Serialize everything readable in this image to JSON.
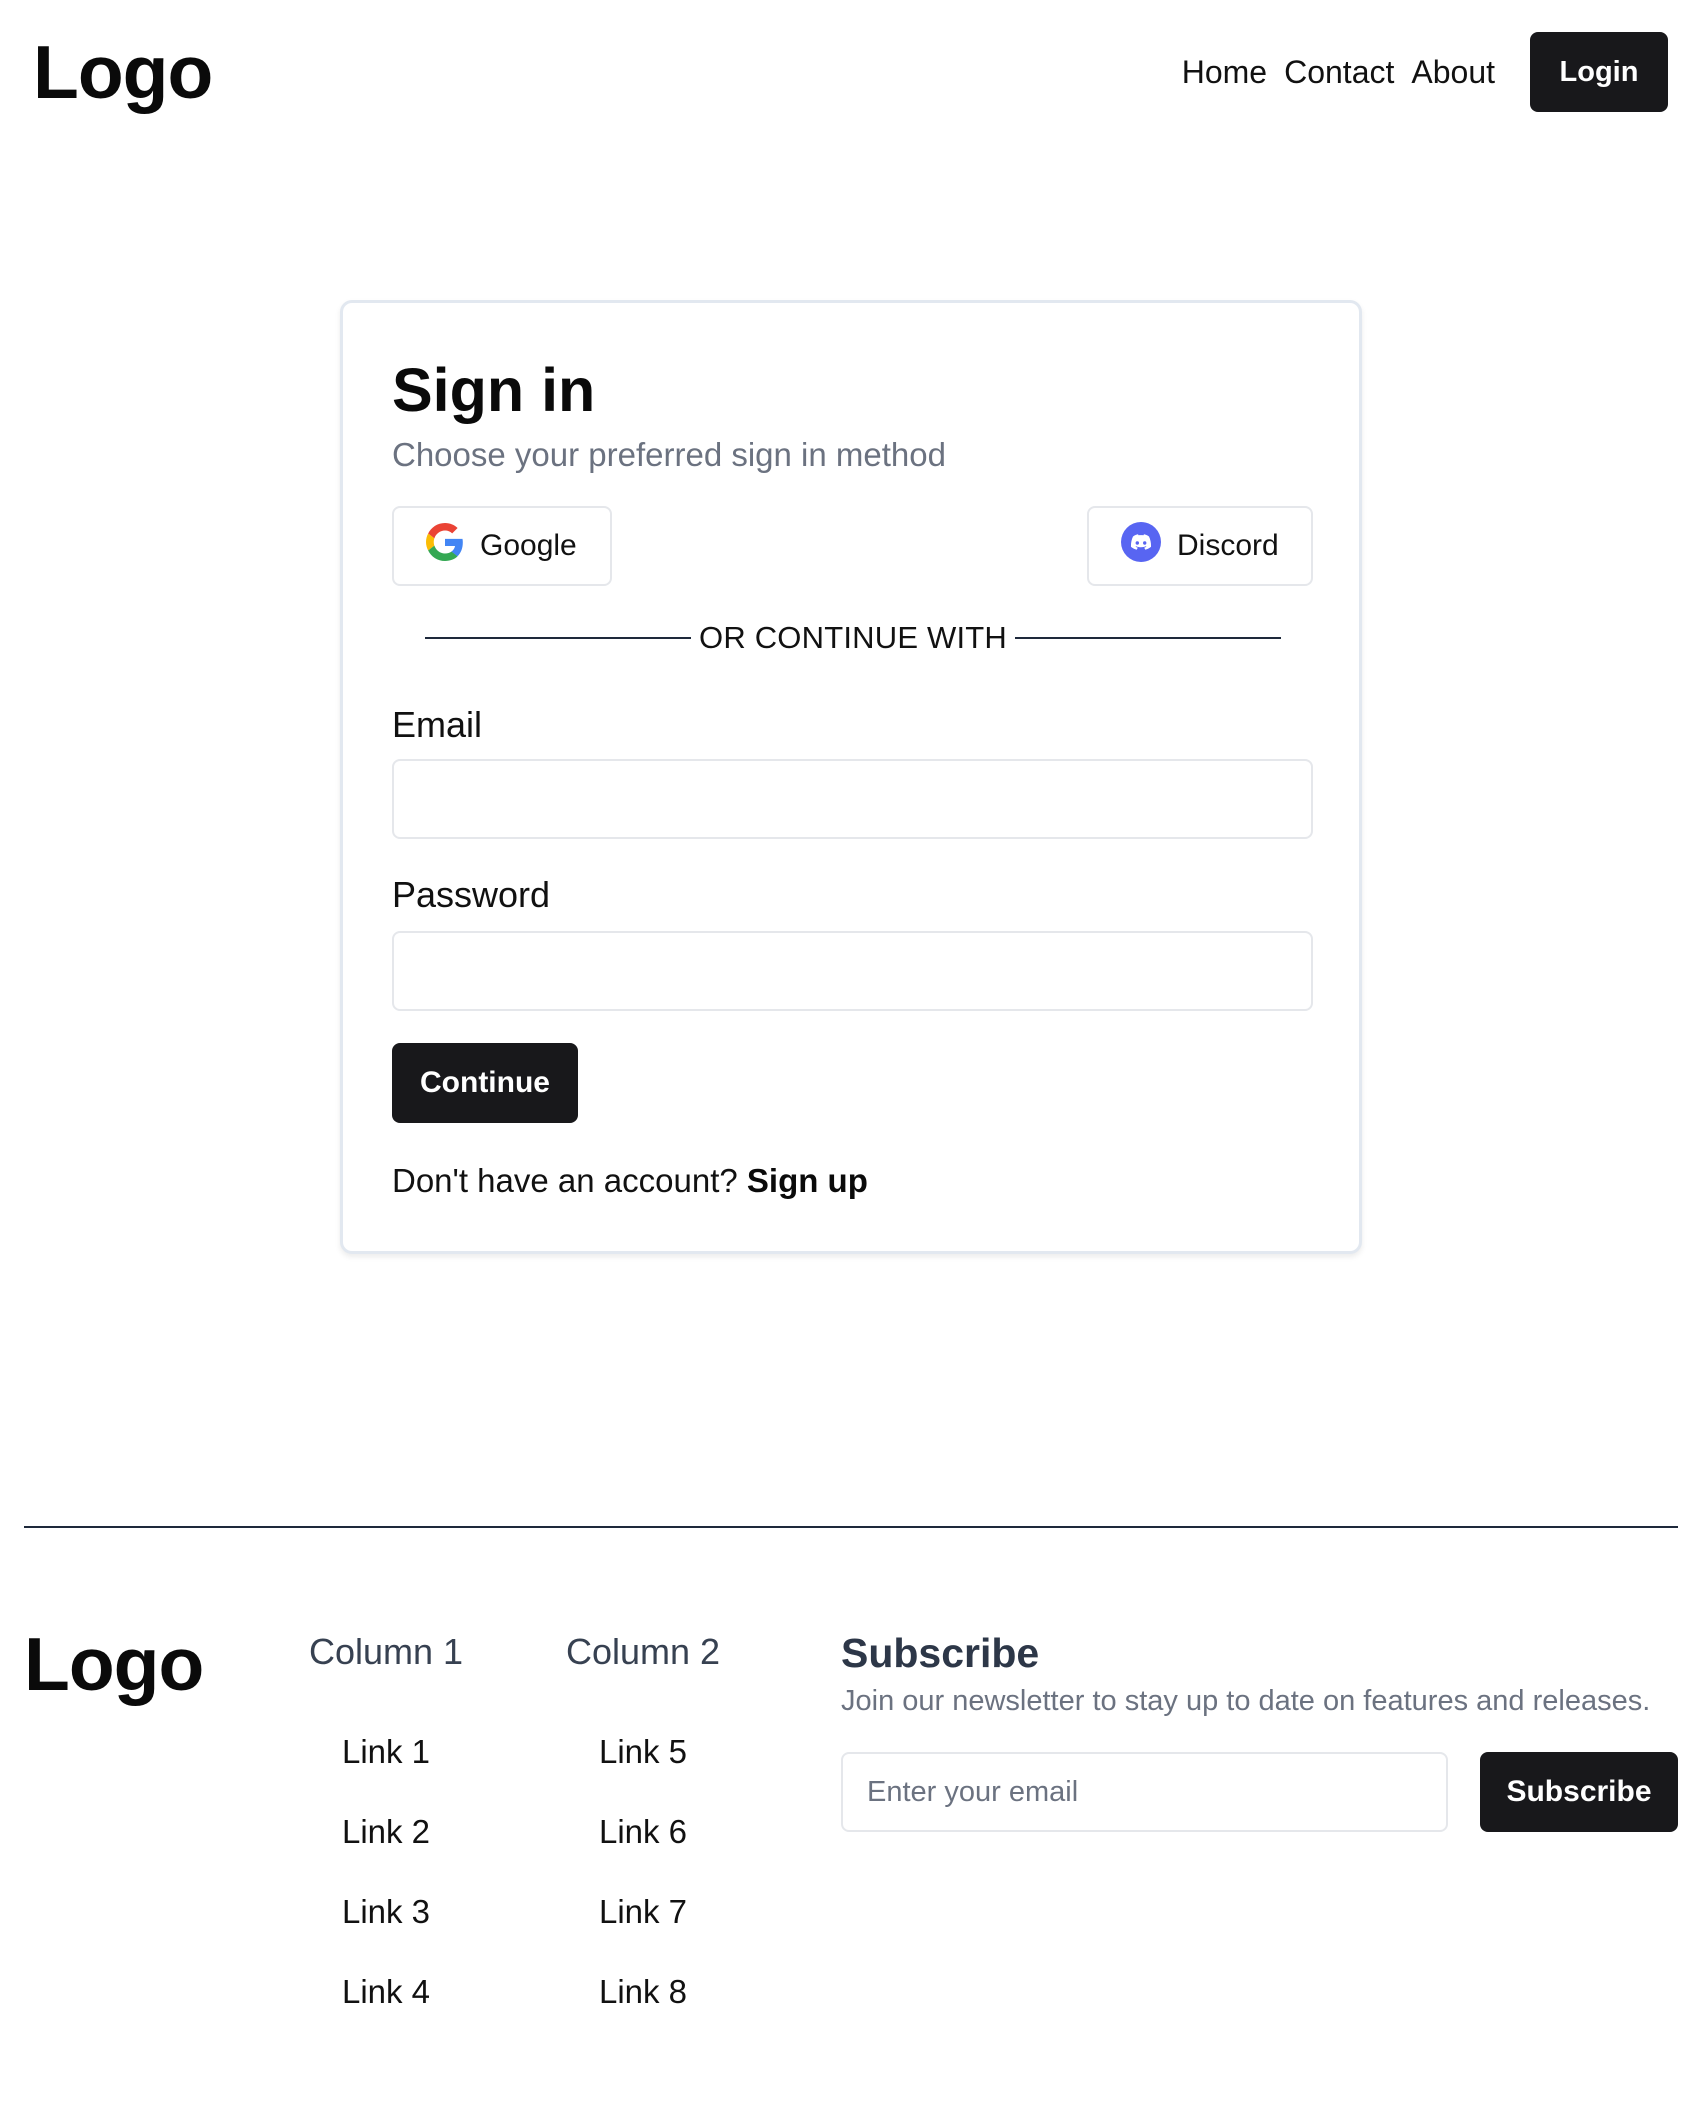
{
  "header": {
    "logo": "Logo",
    "nav": [
      "Home",
      "Contact",
      "About"
    ],
    "login_label": "Login"
  },
  "signin": {
    "title": "Sign in",
    "subtitle": "Choose your preferred sign in method",
    "google_label": "Google",
    "google_icon": "google-icon",
    "discord_label": "Discord",
    "discord_icon": "discord-icon",
    "discord_color": "#5865F2",
    "divider_text": "OR CONTINUE WITH",
    "email_label": "Email",
    "email_value": "",
    "password_label": "Password",
    "password_value": "",
    "continue_label": "Continue",
    "signup_prompt": "Don't have an account?",
    "signup_link": "Sign up"
  },
  "footer": {
    "logo": "Logo",
    "columns": [
      {
        "title": "Column 1",
        "links": [
          "Link 1",
          "Link 2",
          "Link 3",
          "Link 4"
        ]
      },
      {
        "title": "Column 2",
        "links": [
          "Link 5",
          "Link 6",
          "Link 7",
          "Link 8"
        ]
      }
    ],
    "subscribe": {
      "title": "Subscribe",
      "description": "Join our newsletter to stay up to date on features and releases.",
      "placeholder": "Enter your email",
      "button_label": "Subscribe"
    }
  },
  "colors": {
    "primary_button": "#18181b",
    "border": "#e5e7eb",
    "muted_text": "#6b7280"
  }
}
